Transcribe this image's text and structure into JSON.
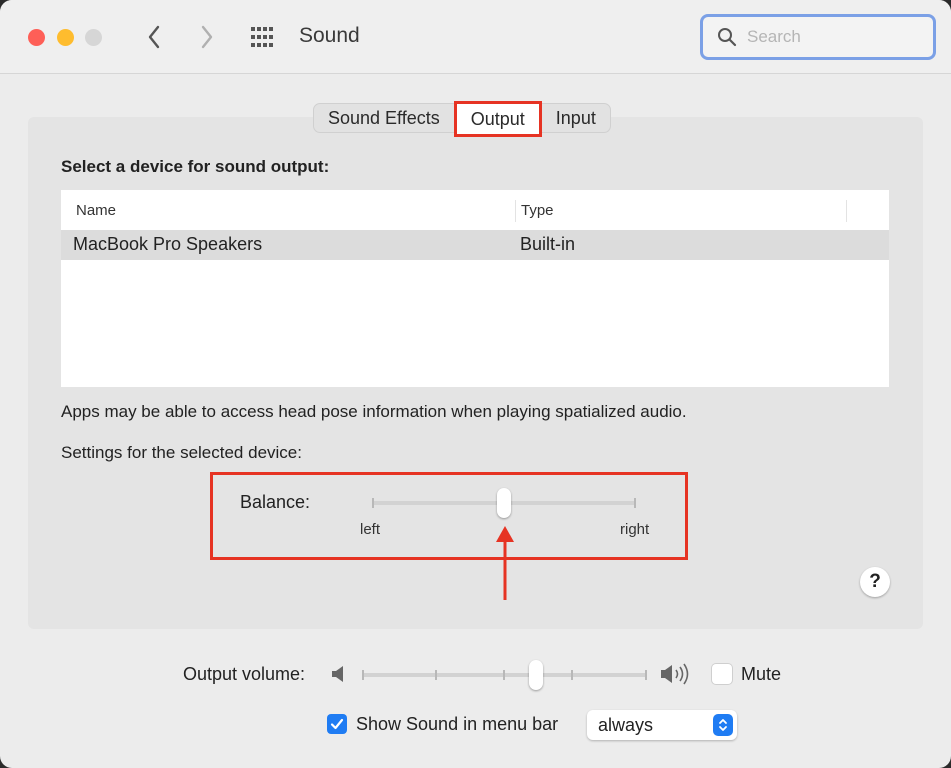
{
  "window": {
    "title": "Sound",
    "search": {
      "placeholder": "Search",
      "value": ""
    }
  },
  "tabs": [
    {
      "label": "Sound Effects",
      "active": false
    },
    {
      "label": "Output",
      "active": true
    },
    {
      "label": "Input",
      "active": false
    }
  ],
  "output": {
    "section_title": "Select a device for sound output:",
    "table": {
      "columns": [
        "Name",
        "Type"
      ],
      "rows": [
        {
          "name": "MacBook Pro Speakers",
          "type": "Built-in",
          "selected": true
        }
      ]
    },
    "note": "Apps may be able to access head pose information when playing spatialized audio.",
    "settings_label": "Settings for the selected device:",
    "balance": {
      "label": "Balance:",
      "left_label": "left",
      "right_label": "right",
      "value": 0.5
    },
    "help_label": "?"
  },
  "footer": {
    "volume_label": "Output volume:",
    "volume_value": 0.61,
    "mute_label": "Mute",
    "mute_checked": false,
    "show_in_menu_label": "Show Sound in menu bar",
    "show_in_menu_checked": true,
    "show_in_menu_option": "always"
  },
  "colors": {
    "annotation_red": "#e63323",
    "accent_blue": "#1f7cf3",
    "search_focus": "#7ba0e6"
  }
}
